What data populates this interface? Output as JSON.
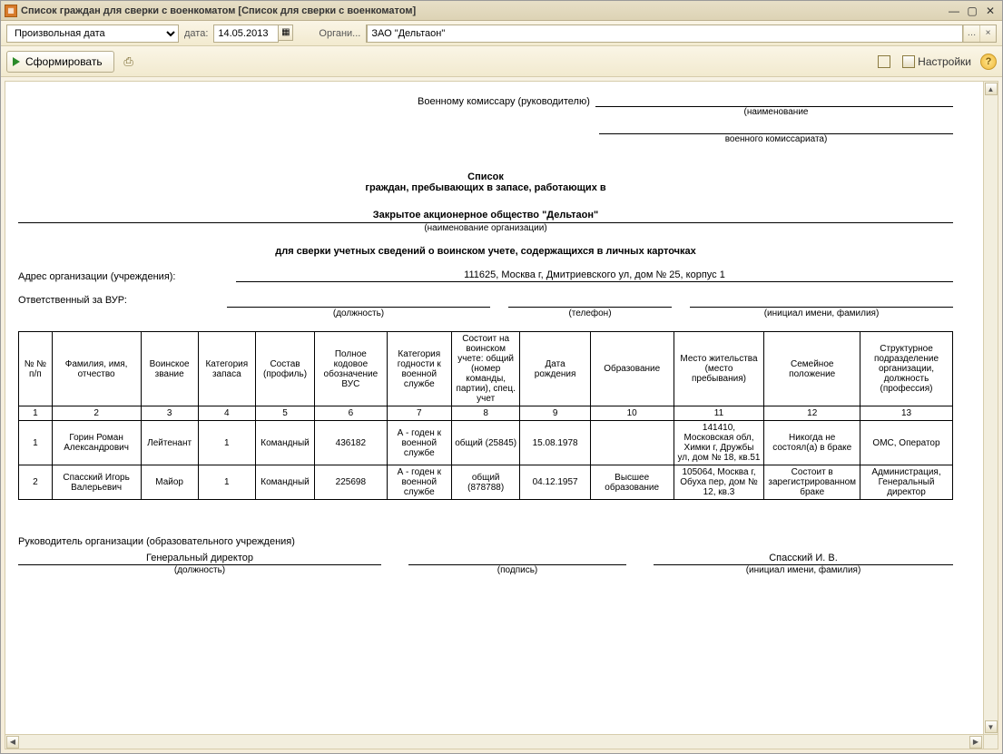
{
  "window": {
    "title": "Список граждан для сверки с военкоматом [Список для сверки с военкоматом]"
  },
  "params": {
    "date_mode": "Произвольная дата",
    "date_label": "дата:",
    "date_value": "14.05.2013",
    "org_label": "Органи...",
    "org_value": "ЗАО \"Дельтаон\""
  },
  "toolbar": {
    "generate": "Сформировать",
    "settings": "Настройки"
  },
  "doc": {
    "addressee_label": "Военному комиссару (руководителю)",
    "addr_sub1": "(наименование",
    "addr_sub2": "военного комиссариата)",
    "heading1": "Список",
    "heading2": "граждан, пребывающих в запасе, работающих в",
    "org_full": "Закрытое акционерное общество \"Дельтаон\"",
    "org_sub": "(наименование организации)",
    "heading3": "для сверки учетных сведений о воинском учете, содержащихся в личных карточках",
    "addr_label": "Адрес организации (учреждения):",
    "addr_value": "111625, Москва г, Дмитриевского ул, дом № 25, корпус 1",
    "vur_label": "Ответственный за ВУР:",
    "vur_cap1": "(должность)",
    "vur_cap2": "(телефон)",
    "vur_cap3": "(инициал имени, фамилия)",
    "columns": [
      "№ № п/п",
      "Фамилия, имя, отчество",
      "Воинское звание",
      "Категория запаса",
      "Состав (профиль)",
      "Полное кодовое обозначение ВУС",
      "Категория годности к военной службе",
      "Состоит на воинском учете: общий (номер команды, партии), спец. учет",
      "Дата рождения",
      "Образование",
      "Место жительства (место пребывания)",
      "Семейное положение",
      "Структурное подразделение организации, должность (профессия)"
    ],
    "colnums": [
      "1",
      "2",
      "3",
      "4",
      "5",
      "6",
      "7",
      "8",
      "9",
      "10",
      "11",
      "12",
      "13"
    ],
    "rows": [
      {
        "n": "1",
        "fio": "Горин Роман Александрович",
        "rank": "Лейтенант",
        "cat": "1",
        "sostav": "Командный",
        "vus": "436182",
        "fit": "А - годен к военной службе",
        "reg": "общий (25845)",
        "dob": "15.08.1978",
        "edu": "",
        "addr": "141410, Московская обл, Химки г, Дружбы ул, дом № 18, кв.51",
        "fam": "Никогда не состоял(а) в браке",
        "pos": "ОМС, Оператор"
      },
      {
        "n": "2",
        "fio": "Спасский Игорь Валерьевич",
        "rank": "Майор",
        "cat": "1",
        "sostav": "Командный",
        "vus": "225698",
        "fit": "А - годен к военной службе",
        "reg": "общий (878788)",
        "dob": "04.12.1957",
        "edu": "Высшее образование",
        "addr": "105064, Москва г, Обуха пер, дом № 12, кв.3",
        "fam": "Состоит в зарегистрированном браке",
        "pos": "Администрация, Генеральный директор"
      }
    ],
    "leader_label": "Руководитель организации (образовательного учреждения)",
    "leader_pos": "Генеральный директор",
    "sig_cap1": "(должность)",
    "sig_cap2": "(подпись)",
    "sig_cap3": "(инициал имени, фамилия)",
    "leader_name": "Спасский И. В."
  }
}
